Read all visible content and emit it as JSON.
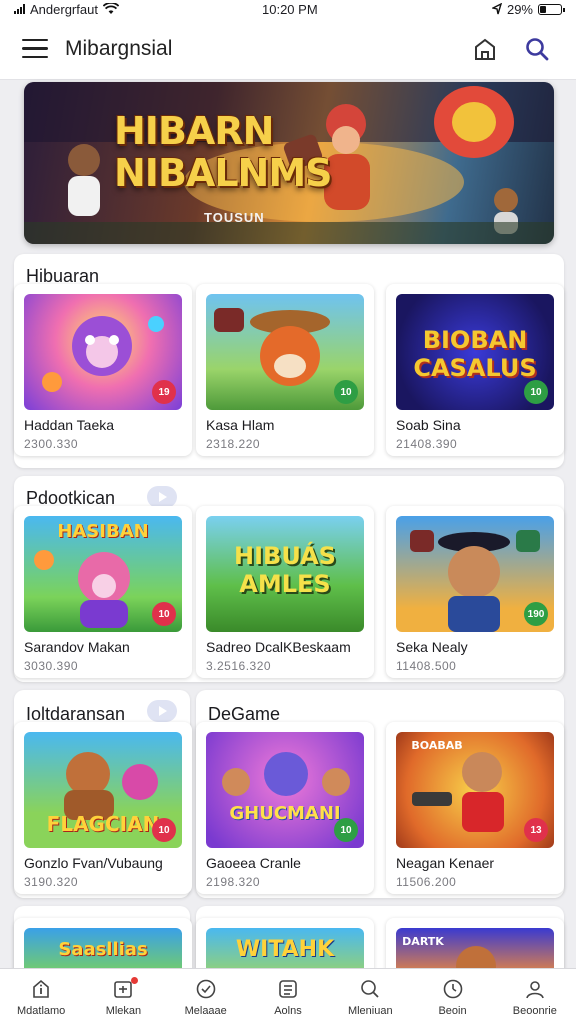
{
  "status": {
    "carrier": "Andergrfaut",
    "time": "10:20 PM",
    "battery": "29%",
    "battery_level": 0.29
  },
  "header": {
    "title": "Mibargnsial"
  },
  "banner": {
    "title_line1": "HIBARN",
    "title_line2": "NIBALNMS",
    "tagline": "TOUSUN"
  },
  "sections": [
    {
      "title": "Hibuaran",
      "cards": [
        {
          "name": "Haddan Taeka",
          "sub": "2300.330",
          "badge": "19",
          "thumb_text": ""
        },
        {
          "name": "Kasa Hlam",
          "sub": "2318.220",
          "badge": "10",
          "thumb_text": ""
        },
        {
          "name": "Soab Sina",
          "sub": "21408.390",
          "badge": "10",
          "thumb_text": "BIOBAN CASALUS"
        }
      ]
    },
    {
      "title": "Pdootkican",
      "cards": [
        {
          "name": "Sarandov Makan",
          "sub": "3030.390",
          "badge": "10",
          "thumb_text": "HASIBAN"
        },
        {
          "name": "Sadreo DcalKBeskaam",
          "sub": "3.2516.320",
          "badge": "",
          "thumb_text": "HIBUÁS AMLES"
        },
        {
          "name": "Seka Nealy",
          "sub": "11408.500",
          "badge": "190",
          "thumb_text": ""
        }
      ]
    },
    {
      "title": "Ioltdaransan",
      "cards": [
        {
          "name": "Gonzlo Fvan/Vubaung",
          "sub": "3190.320",
          "badge": "10",
          "thumb_text": "FLAGCIAN"
        }
      ]
    },
    {
      "title": "DeGame",
      "cards": [
        {
          "name": "Gaoeea Cranle",
          "sub": "2198.320",
          "badge": "10",
          "thumb_text": "GHUCMANI"
        },
        {
          "name": "Neagan Kenaer",
          "sub": "11506.200",
          "badge": "13",
          "thumb_text": "BOABAB"
        }
      ]
    },
    {
      "title": "",
      "cards": [
        {
          "thumb_text": "Saasllias"
        },
        {
          "thumb_text": "WITAHK"
        },
        {
          "thumb_text": "DARTK"
        }
      ]
    }
  ],
  "bottom_nav": [
    {
      "label": "Mdatlamo",
      "icon": "info-icon"
    },
    {
      "label": "Mlekan",
      "icon": "calendar-icon",
      "notify": true
    },
    {
      "label": "Melaaae",
      "icon": "check-circle-icon"
    },
    {
      "label": "Aolns",
      "icon": "list-icon"
    },
    {
      "label": "Mleniuan",
      "icon": "search-icon"
    },
    {
      "label": "Beoin",
      "icon": "timer-icon"
    },
    {
      "label": "Beoonrie",
      "icon": "profile-icon"
    }
  ],
  "colors": {
    "accent": "#3d3a9e",
    "badge_red": "#e0314b",
    "badge_green": "#2e9e44",
    "notify_dot": "#e53935"
  }
}
